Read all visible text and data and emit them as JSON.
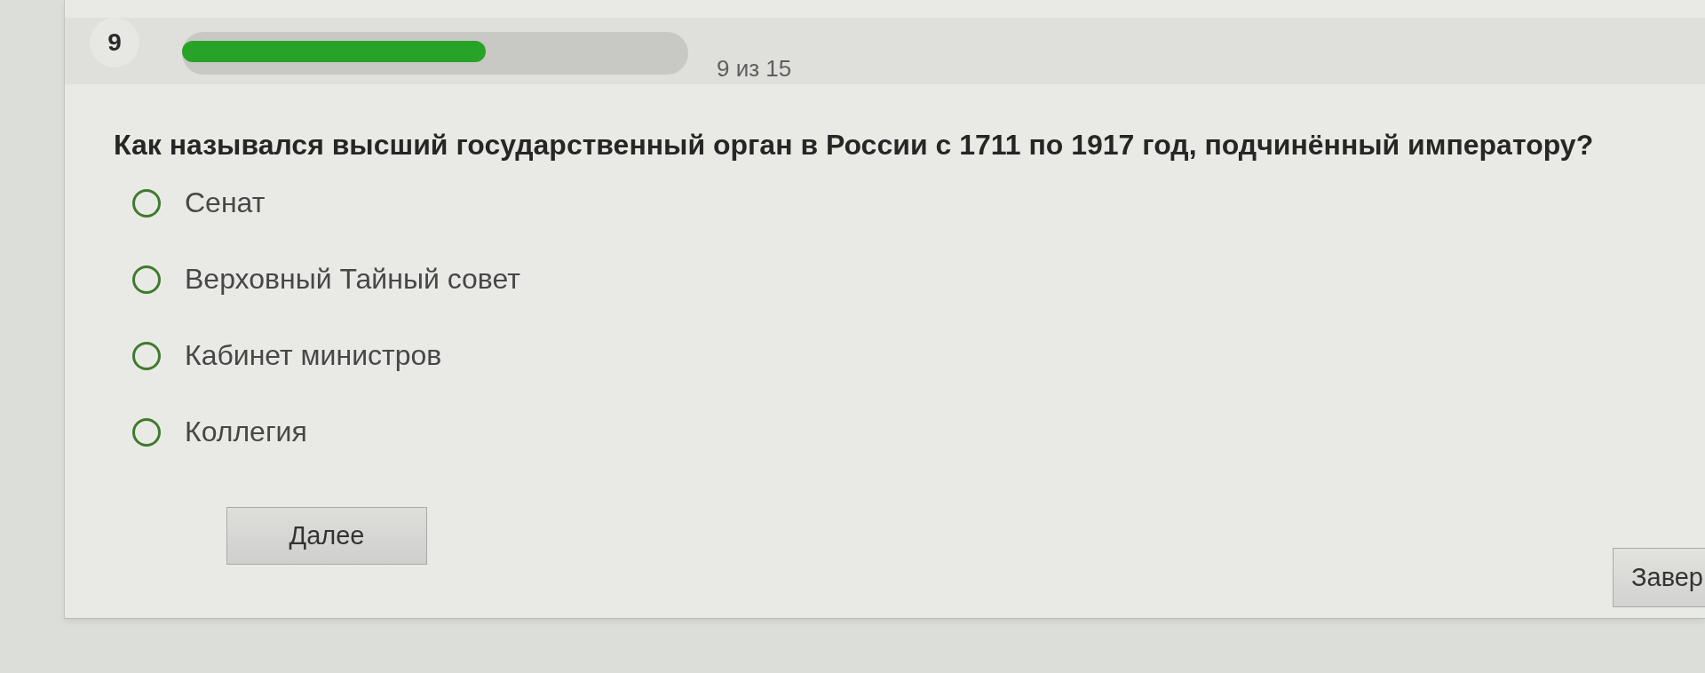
{
  "progress": {
    "question_number": "9",
    "level": 0.6,
    "counter": "9 из 15"
  },
  "question": {
    "text": "Как назывался высший государственный орган в России с 1711 по 1917 год, подчинённый императору?"
  },
  "options": [
    {
      "label": "Сенат",
      "selected": false
    },
    {
      "label": "Верховный Тайный совет",
      "selected": false
    },
    {
      "label": "Кабинет министров",
      "selected": false
    },
    {
      "label": "Коллегия",
      "selected": false
    }
  ],
  "buttons": {
    "next": "Далее",
    "finish": "Завер"
  }
}
